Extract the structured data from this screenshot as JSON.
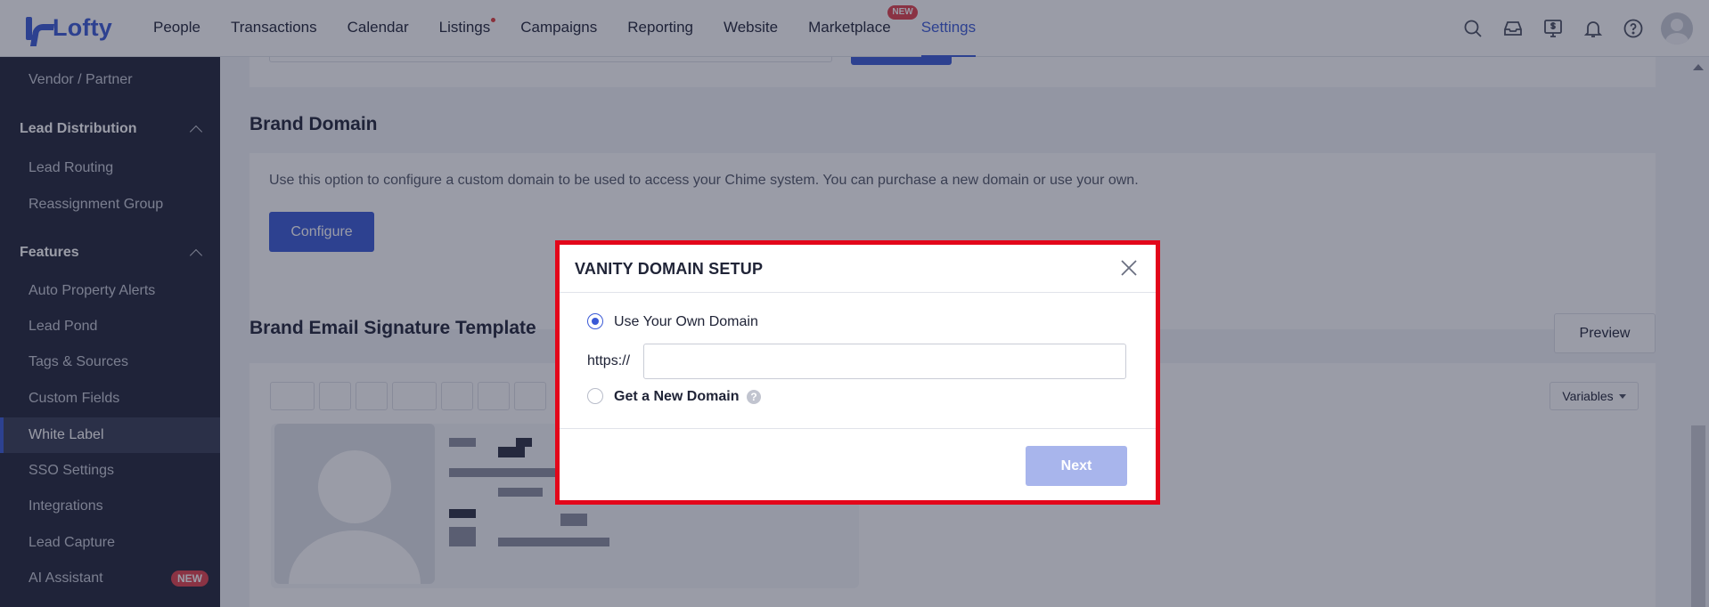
{
  "topnav": {
    "logo_text": "Lofty",
    "items": [
      {
        "label": "People"
      },
      {
        "label": "Transactions"
      },
      {
        "label": "Calendar"
      },
      {
        "label": "Listings"
      },
      {
        "label": "Campaigns"
      },
      {
        "label": "Reporting"
      },
      {
        "label": "Website"
      },
      {
        "label": "Marketplace",
        "badge": "NEW"
      },
      {
        "label": "Settings"
      }
    ],
    "icons": [
      "search-icon",
      "inbox-icon",
      "dollar-screen-icon",
      "bell-icon",
      "help-icon",
      "avatar"
    ]
  },
  "sidebar": {
    "top_item": "Vendor / Partner",
    "groups": [
      {
        "title": "Lead Distribution",
        "items": [
          "Lead Routing",
          "Reassignment Group"
        ]
      },
      {
        "title": "Features",
        "items": [
          "Auto Property Alerts",
          "Lead Pond",
          "Tags & Sources",
          "Custom Fields",
          "White Label",
          "SSO Settings",
          "Integrations",
          "Lead Capture",
          "AI Assistant"
        ]
      }
    ],
    "active_item": "White Label",
    "ai_badge": "NEW"
  },
  "main": {
    "brand_domain": {
      "title": "Brand Domain",
      "description": "Use this option to configure a custom domain to be used to access your Chime system. You can purchase a new domain or use your own.",
      "configure_label": "Configure"
    },
    "brand_email": {
      "title": "Brand Email Signature Template",
      "preview_label": "Preview",
      "variables_label": "Variables"
    }
  },
  "modal": {
    "title": "VANITY DOMAIN SETUP",
    "option_own": "Use Your Own Domain",
    "prefix": "https://",
    "input_value": "",
    "input_placeholder": "",
    "option_new": "Get a New Domain",
    "next_label": "Next",
    "selected": "own"
  },
  "colors": {
    "accent": "#3a59d6",
    "sidebar_bg": "#202437",
    "modal_border": "#e3061a",
    "badge": "#e2404b"
  }
}
